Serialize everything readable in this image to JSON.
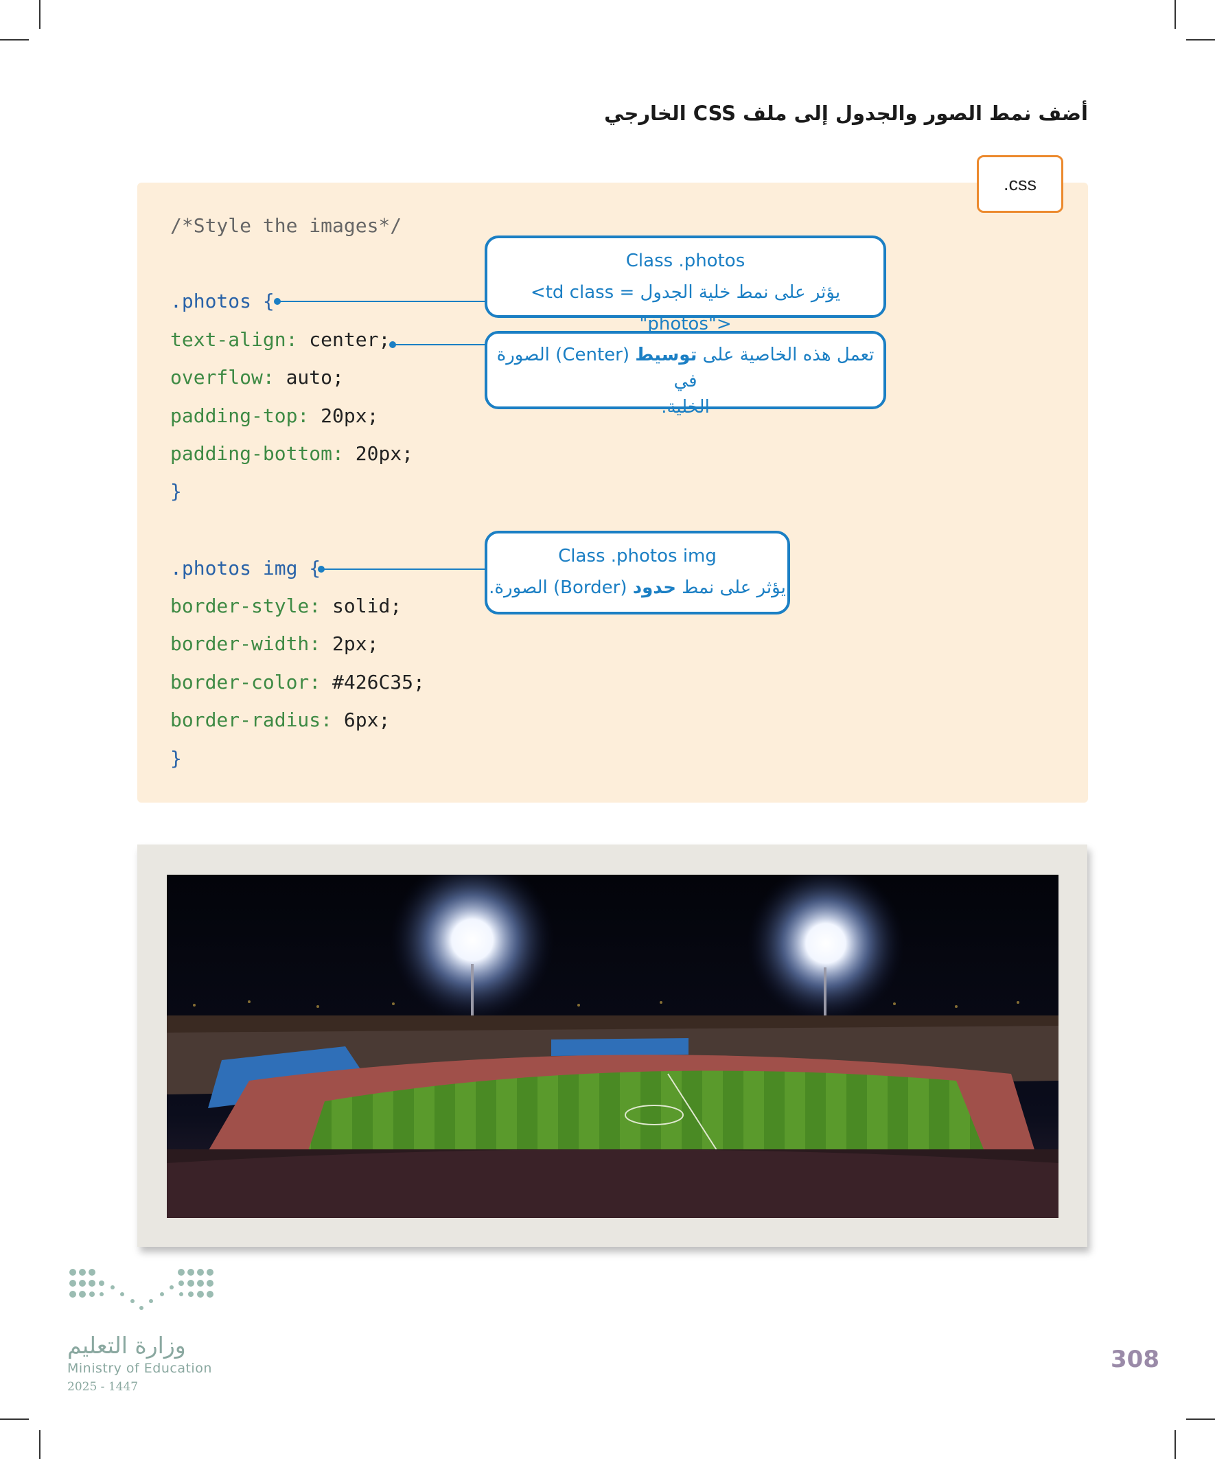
{
  "heading": "أضف نمط الصور والجدول إلى ملف CSS الخارجي",
  "file_tab": ".css",
  "code": {
    "comment": "/*Style the images*/",
    "block1": {
      "selector": ".photos {",
      "props": [
        {
          "name": "text-align:",
          "value": " center;"
        },
        {
          "name": "overflow:",
          "value": " auto;"
        },
        {
          "name": "padding-top:",
          "value": " 20px;"
        },
        {
          "name": "padding-bottom:",
          "value": " 20px;"
        }
      ],
      "close": "}"
    },
    "block2": {
      "selector": ".photos img {",
      "props": [
        {
          "name": "border-style:",
          "value": " solid;"
        },
        {
          "name": "border-width:",
          "value": " 2px;"
        },
        {
          "name": "border-color:",
          "value": " #426C35;"
        },
        {
          "name": "border-radius:",
          "value": " 6px;"
        }
      ],
      "close": "}"
    }
  },
  "callouts": {
    "photos_class": {
      "title": "Class .photos",
      "desc_ar": "يؤثر على نمط خلية الجدول",
      "desc_code": "<td class = \"photos\">"
    },
    "center": {
      "pre": "تعمل هذه الخاصية على ",
      "bold": "توسيط",
      "post": " (Center) الصورة في",
      "line2": "الخلية."
    },
    "img_class": {
      "title": "Class .photos img",
      "pre": "يؤثر على نمط ",
      "bold": "حدود",
      "post": " (Border) الصورة."
    }
  },
  "ministry": {
    "arabic": "وزارة التعليم",
    "english": "Ministry of Education",
    "year": "2025 - 1447"
  },
  "page_number": "308",
  "colors": {
    "code_bg": "#fdeeda",
    "selector": "#2a63a8",
    "property": "#3e8a44",
    "callout": "#1b7fc4",
    "tab_border": "#ec8a2e"
  }
}
